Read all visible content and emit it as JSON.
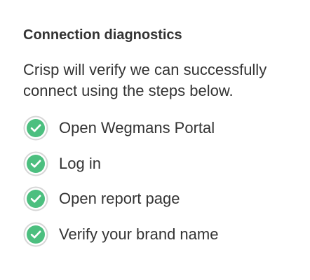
{
  "panel": {
    "title": "Connection diagnostics",
    "description": "Crisp will verify we can successfully connect using the steps below."
  },
  "steps": [
    {
      "label": "Open Wegmans Portal",
      "status": "success",
      "icon": "check-circle-icon"
    },
    {
      "label": "Log in",
      "status": "success",
      "icon": "check-circle-icon"
    },
    {
      "label": "Open report page",
      "status": "success",
      "icon": "check-circle-icon"
    },
    {
      "label": "Verify your brand name",
      "status": "success",
      "icon": "check-circle-icon"
    }
  ],
  "colors": {
    "text": "#333333",
    "success_fill": "#4cbf7f",
    "success_ring": "#d6d6d6",
    "check_mark": "#ffffff"
  }
}
